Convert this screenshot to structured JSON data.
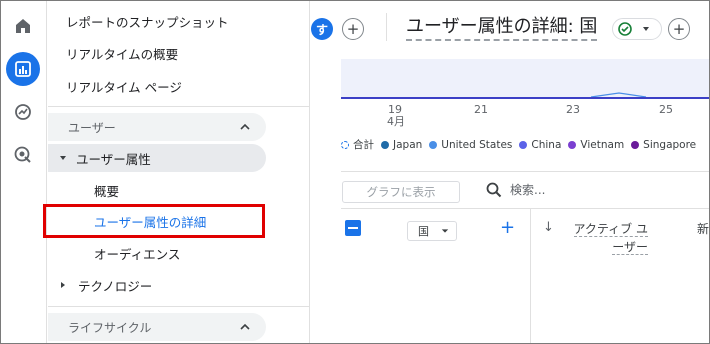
{
  "rail": {
    "icons": [
      "home-icon",
      "reports-icon",
      "explore-icon",
      "advertising-icon"
    ]
  },
  "sidebar": {
    "items_top": [
      {
        "label": "レポートのスナップショット"
      },
      {
        "label": "リアルタイムの概要"
      },
      {
        "label": "リアルタイム ページ"
      }
    ],
    "section_user": "ユーザー",
    "group_user_attr": "ユーザー属性",
    "sub_overview": "概要",
    "sub_detail": "ユーザー属性の詳細",
    "sub_audience": "オーディエンス",
    "group_tech": "テクノロジー",
    "section_lifecycle": "ライフサイクル"
  },
  "header": {
    "avatar_letter": "す",
    "add": "+",
    "title": "ユーザー属性の詳細: 国",
    "status_add": "+"
  },
  "chart": {
    "x_ticks": [
      "19",
      "21",
      "23",
      "25"
    ],
    "x_month": "4月",
    "legend": [
      {
        "name": "合計",
        "color": "#1a73e8"
      },
      {
        "name": "Japan",
        "color": "#1f6ba8"
      },
      {
        "name": "United States",
        "color": "#4a8fe7"
      },
      {
        "name": "China",
        "color": "#5b62e8"
      },
      {
        "name": "Vietnam",
        "color": "#7b3fd1"
      },
      {
        "name": "Singapore",
        "color": "#6a1b9a"
      }
    ]
  },
  "table": {
    "graph_button": "グラフに表示",
    "search_placeholder": "検索...",
    "dimension": "国",
    "add_dim": "+",
    "sort_arrow": "↓",
    "col_active_line1": "アクティブ ユ",
    "col_active_line2": "ーザー",
    "col_next": "新"
  }
}
